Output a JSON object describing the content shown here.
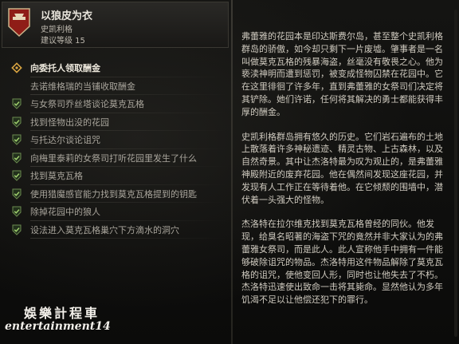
{
  "quest": {
    "title": "以狼皮为衣",
    "location": "史凯利格",
    "level": "建议等级 15",
    "badge_color": "#8f1d17"
  },
  "objectives": [
    {
      "label": "向委托人领取酬金",
      "state": "active",
      "icon": "diamond-marker-icon"
    },
    {
      "label": "去诺维格瑞的当铺收取酬金",
      "state": "pending",
      "icon": "empty-marker-icon"
    },
    {
      "label": "与女祭司乔丝塔谈论莫克瓦格",
      "state": "done",
      "icon": "shield-check-icon"
    },
    {
      "label": "找到怪物出没的花园",
      "state": "done",
      "icon": "shield-check-icon"
    },
    {
      "label": "与托达尔谈论诅咒",
      "state": "done",
      "icon": "shield-check-icon"
    },
    {
      "label": "向梅里泰莉的女祭司打听花园里发生了什么",
      "state": "done",
      "icon": "shield-check-icon"
    },
    {
      "label": "找到莫克瓦格",
      "state": "done",
      "icon": "shield-check-icon"
    },
    {
      "label": "使用猎魔感官能力找到莫克瓦格提到的钥匙",
      "state": "done",
      "icon": "shield-check-icon"
    },
    {
      "label": "除掉花园中的狼人",
      "state": "done",
      "icon": "shield-check-icon"
    },
    {
      "label": "设法进入莫克瓦格巢穴下方滴水的洞穴",
      "state": "done",
      "icon": "shield-check-icon"
    }
  ],
  "description": [
    "弗蕾雅的花园本是印达斯费尔岛，甚至整个史凯利格群岛的骄傲，如今却只剩下一片废墟。肇事者是一名叫做莫克瓦格的残暴海盗，丝毫没有敬畏之心。他为亵渎神明而遭到惩罚，被变成怪物囚禁在花园中。它在这里徘徊了许多年，直到弗蕾雅的女祭司们决定将其铲除。她们许诺，任何将其解决的勇士都能获得丰厚的酬金。",
    "史凯利格群岛拥有悠久的历史。它们岩石遍布的土地上散落着许多神秘遗迹、精灵古物、上古森林，以及自然奇景。其中让杰洛特最为叹为观止的，是弗蕾雅神殿附近的废弃花园。他在偶然间发现这座花园，并发现有人工作正在等待着他。在它倾颓的围墙中，潜伏着一头强大的怪物。",
    "杰洛特在拉尔维克找到莫克瓦格曾经的同伙。他发现，给臭名昭著的海盗下咒的竟然并非大家认为的弗蕾雅女祭司，而是此人。此人宣称他手中拥有一件能够破除诅咒的物品。杰洛特用这件物品解除了莫克瓦格的诅咒，使他变回人形，同时也让他失去了不朽。杰洛特迅速使出致命一击将其毙命。显然他认为多年饥渴不足以让他偿还犯下的罪行。"
  ],
  "watermark": {
    "line1": "娛樂計程車",
    "line2": "entertainment14"
  }
}
